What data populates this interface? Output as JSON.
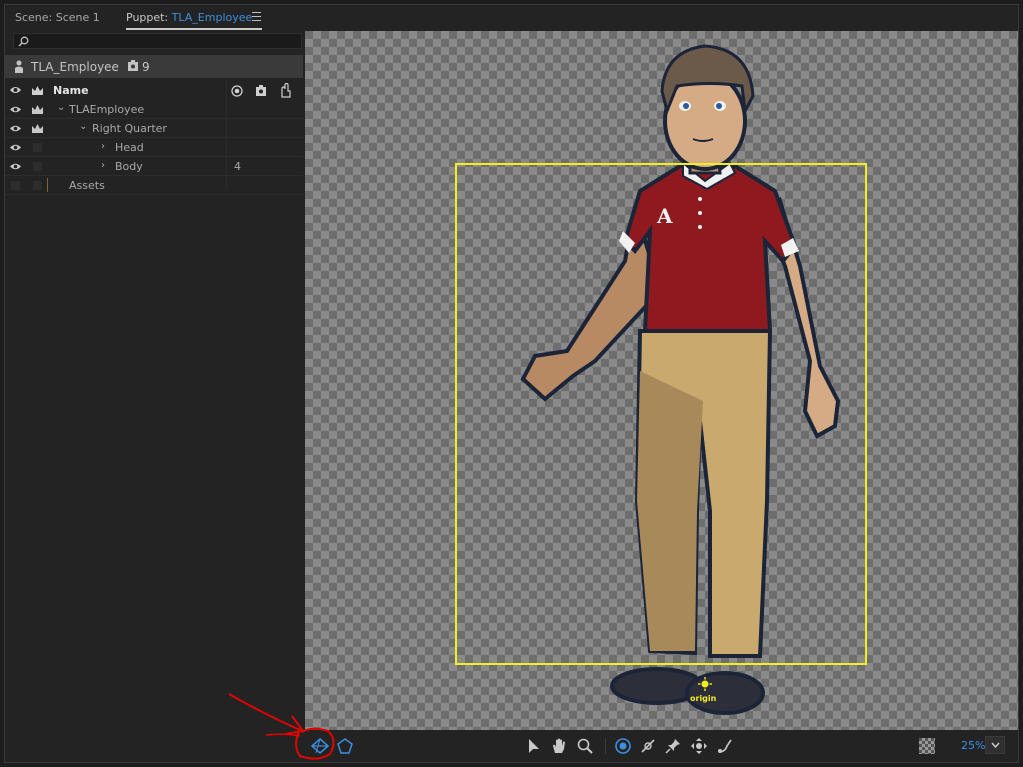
{
  "tabs": {
    "scene_label": "Scene: Scene 1",
    "puppet_prefix": "Puppet: ",
    "puppet_name": "TLA_Employee"
  },
  "panel": {
    "search_placeholder": "",
    "puppet_title": "TLA_Employee",
    "tag_count": "9",
    "column_name": "Name",
    "rows": [
      {
        "label": "TLAEmployee",
        "value": ""
      },
      {
        "label": "Right Quarter",
        "value": ""
      },
      {
        "label": "Head",
        "value": ""
      },
      {
        "label": "Body",
        "value": "4"
      },
      {
        "label": "Assets",
        "value": ""
      }
    ]
  },
  "canvas": {
    "origin_label": "origin"
  },
  "toolbar": {
    "zoom": "25%"
  },
  "colors": {
    "accent": "#3d8fe0",
    "bounding_box": "#f3ee1f",
    "annotation": "#e00000"
  }
}
